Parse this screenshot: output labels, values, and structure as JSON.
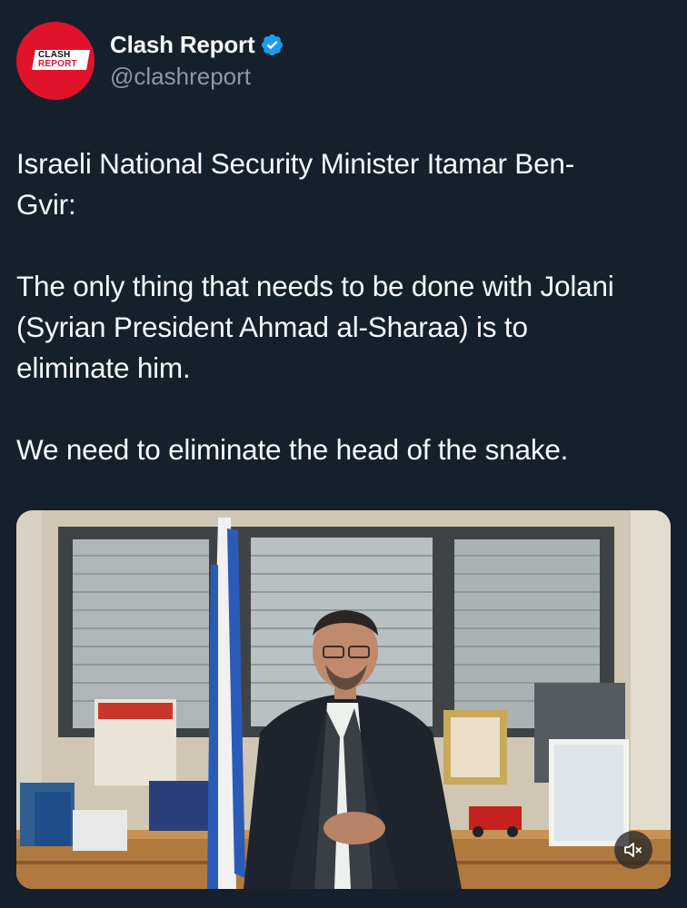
{
  "account": {
    "display_name": "Clash Report",
    "handle": "@clashreport",
    "avatar_logo_line1": "CLASH",
    "avatar_logo_line2": "REPORT",
    "verified_color": "#1d9bf0"
  },
  "tweet": {
    "line1": "Israeli National Security Minister Itamar Ben-",
    "line2": "Gvir:",
    "para2_line1": "The only thing that needs to be done with Jolani",
    "para2_line2": "(Syrian President Ahmad al-Sharaa) is to",
    "para2_line3": "eliminate him.",
    "para3_line1": "We need to eliminate the head of the snake."
  },
  "media": {
    "type": "video",
    "mute_icon": "speaker-muted-icon",
    "colors": {
      "background": "#15202b",
      "text": "#f7f9f9",
      "secondary": "#8b98a5"
    }
  }
}
